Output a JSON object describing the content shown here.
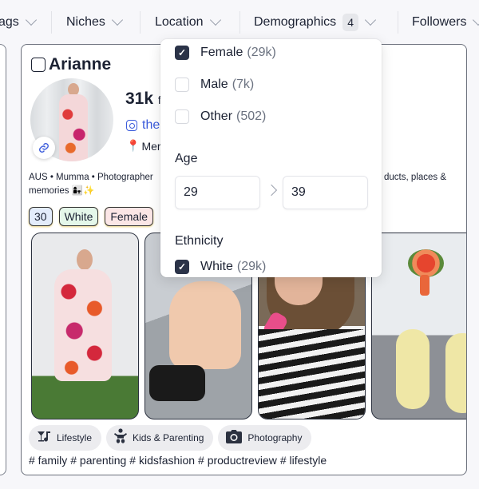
{
  "filters": {
    "items": [
      {
        "label": "Tags",
        "visible_text": "ags"
      },
      {
        "label": "Niches"
      },
      {
        "label": "Location"
      },
      {
        "label": "Demographics",
        "badge": "4"
      },
      {
        "label": "Followers"
      }
    ]
  },
  "creator": {
    "name": "Arianne",
    "followers_value": "31k",
    "followers_suffix": "fo",
    "instagram_handle": "the",
    "location": "Mer",
    "bio_left_line1": "AUS • Mumma • Photographer",
    "bio_left_line2": "memories 👩‍👧✨",
    "bio_right_line1": "ducts, places &",
    "tags": [
      {
        "label": "30",
        "bg": "#e3ecfb"
      },
      {
        "label": "White",
        "bg": "#e4f7e9"
      },
      {
        "label": "Female",
        "bg": "#fbe6e6"
      }
    ],
    "niches": [
      {
        "icon": "cocktail-music-icon",
        "glyph": "🍸",
        "label": "Lifestyle"
      },
      {
        "icon": "baby-icon",
        "glyph": "👶",
        "label": "Kids & Parenting"
      },
      {
        "icon": "camera-icon",
        "glyph": "📷",
        "label": "Photography"
      }
    ],
    "hashtags": [
      "# family",
      "# parenting",
      "# kidsfashion",
      "# productreview",
      "# lifestyle"
    ]
  },
  "demographics_dropdown": {
    "gender": [
      {
        "label": "Female",
        "count": "(29k)",
        "checked": true
      },
      {
        "label": "Male",
        "count": "(7k)",
        "checked": false
      },
      {
        "label": "Other",
        "count": "(502)",
        "checked": false
      }
    ],
    "age_label": "Age",
    "age_min": "29",
    "age_max": "39",
    "ethnicity_label": "Ethnicity",
    "ethnicity": [
      {
        "label": "White",
        "count": "(29k)",
        "checked": true
      }
    ]
  }
}
